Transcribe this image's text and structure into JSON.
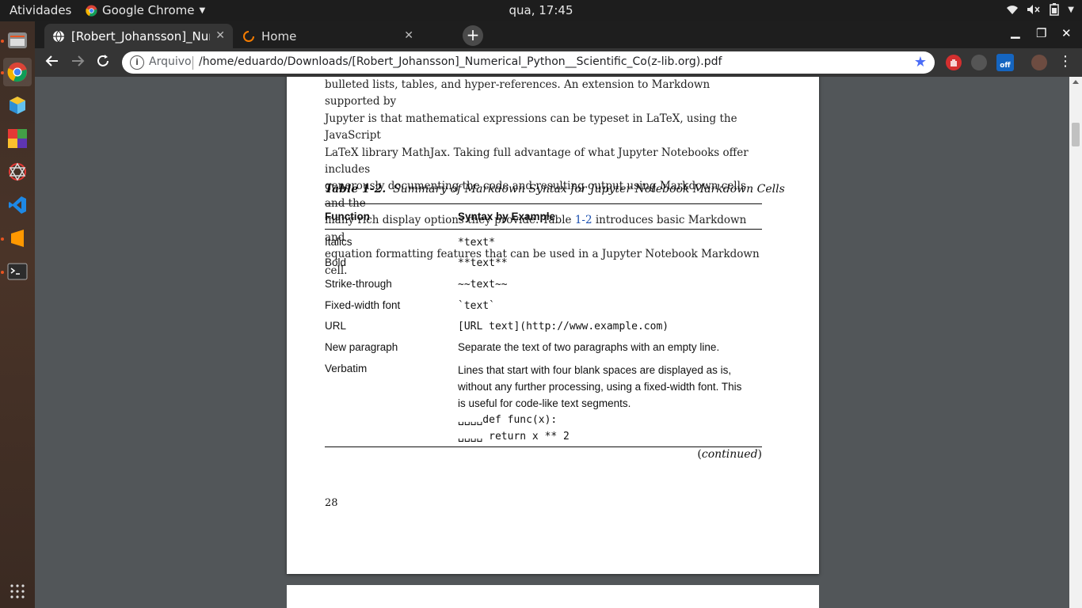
{
  "topbar": {
    "activities": "Atividades",
    "app_name": "Google Chrome",
    "clock": "qua, 17:45"
  },
  "dock": {
    "items": [
      "file-manager",
      "google-chrome",
      "3d-app",
      "color-app",
      "network-app",
      "vscode",
      "sublime-text",
      "terminal"
    ],
    "show_apps_icon": "grid-icon"
  },
  "tabs": [
    {
      "title": "[Robert_Johansson]_Num",
      "active": true
    },
    {
      "title": "Home",
      "active": false
    }
  ],
  "toolbar": {
    "scheme_label": "Arquivo",
    "url": "/home/eduardo/Downloads/[Robert_Johansson]_Numerical_Python__Scientific_Co(z-lib.org).pdf"
  },
  "extensions": {
    "badge_label": "off"
  },
  "pdf": {
    "para_lines": [
      "bulleted lists, tables, and hyper-references. An extension to Markdown supported by",
      "Jupyter is that mathematical expressions can be typeset in LaTeX, using the JavaScript",
      "LaTeX library MathJax. Taking full advantage of what Jupyter Notebooks offer includes",
      "generously documenting the code and resulting output using Markdown cells and the"
    ],
    "para_line5_pre": "many rich display options they provide. Table ",
    "para_line5_link": "1-2",
    "para_line5_post": " introduces basic Markdown and",
    "para_line6": "equation formatting features that can be used in a Jupyter Notebook Markdown cell.",
    "table_caption_label": "Table 1-2.",
    "table_caption_text": "Summary of Markdown Syntax for Jupyter Notebook Markdown Cells",
    "table_headers": [
      "Function",
      "Syntax by Example"
    ],
    "table_rows": [
      {
        "function": "Italics",
        "syntax": "*text*"
      },
      {
        "function": "Bold",
        "syntax": "**text**"
      },
      {
        "function": "Strike-through",
        "syntax": "~~text~~"
      },
      {
        "function": "Fixed-width font",
        "syntax": "`text`"
      },
      {
        "function": "URL",
        "syntax": "[URL text](http://www.example.com)"
      },
      {
        "function": "New paragraph",
        "syntax": "Separate the text of two paragraphs with an empty line."
      },
      {
        "function": "Verbatim",
        "syntax": "Lines that start with four blank spaces are displayed as is, without any further processing, using a fixed-width font. This is useful for code-like text segments."
      }
    ],
    "verbatim_code_1": "␣␣␣␣def func(x):",
    "verbatim_code_2": "␣␣␣␣    return x ** 2",
    "continued": "(continued)",
    "page_number": "28"
  },
  "colors": {
    "accent_orange": "#e95420",
    "link_blue": "#1a4fb0",
    "viewer_bg": "#525659"
  }
}
